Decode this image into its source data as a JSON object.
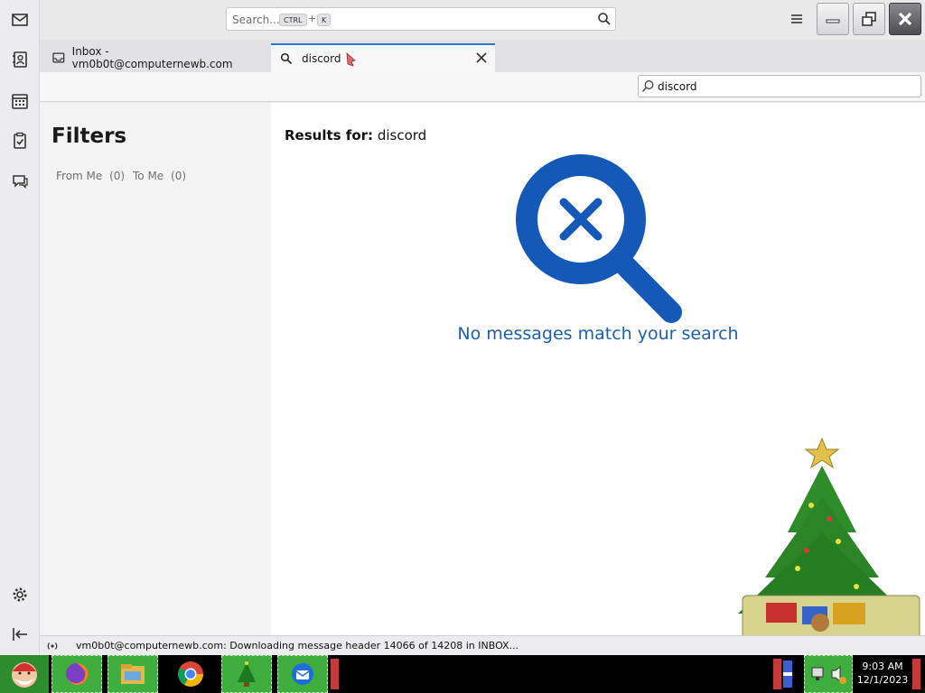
{
  "titlebar": {
    "search_placeholder": "Search...",
    "kbd_ctrl": "CTRL",
    "kbd_plus": "+",
    "kbd_k": "K"
  },
  "tabs": [
    {
      "label": "Inbox - vm0b0t@computernewb.com",
      "icon": "mail-icon"
    },
    {
      "label": "discord",
      "icon": "search-icon",
      "active": true
    }
  ],
  "quick_filter": {
    "value": "discord"
  },
  "filters": {
    "title": "Filters",
    "facets": [
      {
        "label": "From Me",
        "count": "(0)"
      },
      {
        "label": "To Me",
        "count": "(0)"
      }
    ]
  },
  "results": {
    "label": "Results for:",
    "term": "discord",
    "empty_message": "No messages match your search"
  },
  "status": {
    "text": "vm0b0t@computernewb.com: Downloading message header 14066 of 14208 in INBOX..."
  },
  "taskbar": {
    "time": "9:03 AM",
    "date": "12/1/2023"
  },
  "colors": {
    "accent": "#2a7bd4",
    "empty_icon": "#1458b8",
    "message": "#1b5fb3",
    "taskbar_green": "#3fae3f"
  }
}
